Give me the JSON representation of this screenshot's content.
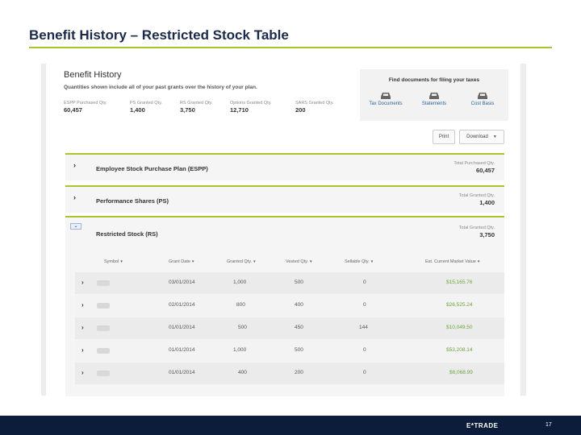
{
  "slide": {
    "title": "Benefit History – Restricted Stock Table",
    "page_number": "17",
    "brand": "E*TRADE"
  },
  "benefit_history": {
    "title": "Benefit History",
    "subtitle": "Quantities shown include all of your past grants over the history of your plan.",
    "stats": [
      {
        "label": "ESPP Purchased Qty.",
        "value": "60,457"
      },
      {
        "label": "PS Granted Qty.",
        "value": "1,400"
      },
      {
        "label": "RS Granted Qty.",
        "value": "3,750"
      },
      {
        "label": "Options Granted Qty.",
        "value": "12,710"
      },
      {
        "label": "SARS Granted Qty.",
        "value": "200"
      }
    ]
  },
  "docs": {
    "title": "Find documents for filing your taxes",
    "items": [
      {
        "label": "Tax Documents",
        "icon": "tray-icon"
      },
      {
        "label": "Statements",
        "icon": "tray-icon"
      },
      {
        "label": "Cost Basis",
        "icon": "tray-icon"
      }
    ]
  },
  "actions": {
    "print": "Print",
    "download": "Download"
  },
  "plans": [
    {
      "title": "Employee Stock Purchase Plan (ESPP)",
      "right_label": "Total Purchased Qty.",
      "right_value": "60,457"
    },
    {
      "title": "Performance Shares (PS)",
      "right_label": "Total Granted Qty.",
      "right_value": "1,400"
    },
    {
      "title": "Restricted Stock (RS)",
      "right_label": "Total Granted Qty.",
      "right_value": "3,750"
    }
  ],
  "rs_table": {
    "columns": [
      "Symbol",
      "Grant Date",
      "Granted Qty.",
      "Vested Qty.",
      "Sellable Qty.",
      "Est. Current Market Value"
    ],
    "rows": [
      {
        "grant_date": "03/01/2014",
        "granted": "1,000",
        "vested": "500",
        "sellable": "0",
        "value": "$15,165.76"
      },
      {
        "grant_date": "02/01/2014",
        "granted": "800",
        "vested": "400",
        "sellable": "0",
        "value": "$26,525.24"
      },
      {
        "grant_date": "01/01/2014",
        "granted": "500",
        "vested": "450",
        "sellable": "144",
        "value": "$10,049.50"
      },
      {
        "grant_date": "01/01/2014",
        "granted": "1,000",
        "vested": "500",
        "sellable": "0",
        "value": "$53,208.14"
      },
      {
        "grant_date": "01/01/2014",
        "granted": "400",
        "vested": "200",
        "sellable": "0",
        "value": "$6,068.99"
      }
    ]
  },
  "colors": {
    "accent": "#a8c52a",
    "navy": "#0b1d3a",
    "money": "#6ea640"
  }
}
